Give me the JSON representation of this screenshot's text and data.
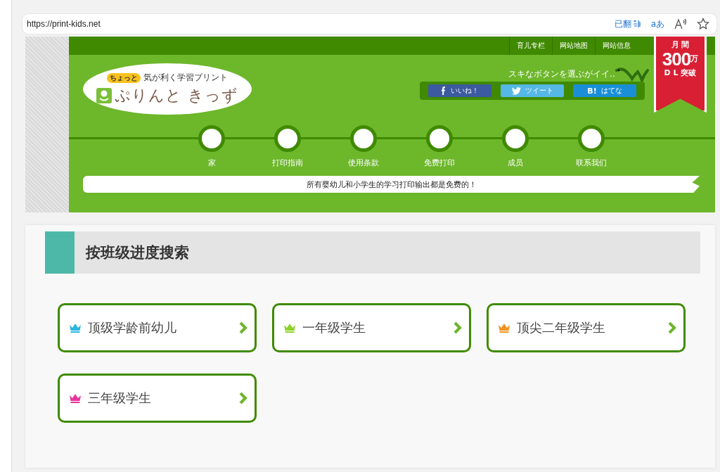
{
  "browser": {
    "url": "https://print-kids.net",
    "translate_label": "已翻",
    "font_label": "aあ"
  },
  "header": {
    "logo": {
      "badge": "ちょっと",
      "tagline": "気が利く学習プリント",
      "name": "ぷりんと きっず"
    },
    "top_links": [
      "育儿专栏",
      "网站地图",
      "网站信息"
    ],
    "share_prompt": "スキなボタンを選ぶがイイ‥",
    "share_buttons": [
      {
        "kind": "facebook",
        "label": "いいね！"
      },
      {
        "kind": "twitter",
        "label": "ツイート"
      },
      {
        "kind": "hatena",
        "mark": "B!",
        "label": "はてな"
      }
    ],
    "ribbon": {
      "line_1": "月 間",
      "number": "300",
      "unit": "万",
      "line_3": "D L 突破"
    },
    "nav": [
      "家",
      "打印指南",
      "使用条款",
      "免费打印",
      "成员",
      "联系我们"
    ],
    "banner": "所有婴幼儿和小学生的学习打印输出都是免费的！"
  },
  "section": {
    "title": "按班级进度搜索",
    "cards": [
      {
        "label": "顶级学龄前幼儿",
        "color": "#29b6e0"
      },
      {
        "label": "一年级学生",
        "color": "#8fd22a"
      },
      {
        "label": "顶尖二年级学生",
        "color": "#f0941e"
      },
      {
        "label": "三年级学生",
        "color": "#e8359c"
      }
    ]
  }
}
